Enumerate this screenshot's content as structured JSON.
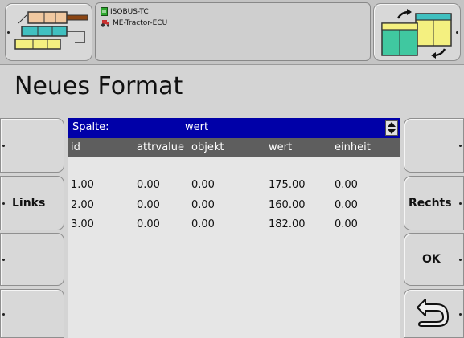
{
  "status": {
    "line1": "ISOBUS-TC",
    "line2": "ME-Tractor-ECU",
    "line1_icon": "document-icon",
    "line2_icon": "tractor-icon"
  },
  "page_title": "Neues Format",
  "table": {
    "selector_label": "Spalte:",
    "selector_value": "wert",
    "columns": [
      "id",
      "attrvalue",
      "objekt",
      "wert",
      "einheit"
    ],
    "rows": [
      [
        "1.00",
        "0.00",
        "0.00",
        "175.00",
        "0.00"
      ],
      [
        "2.00",
        "0.00",
        "0.00",
        "160.00",
        "0.00"
      ],
      [
        "3.00",
        "0.00",
        "0.00",
        "182.00",
        "0.00"
      ]
    ]
  },
  "softkeys": {
    "left_2": "Links",
    "right_2": "Rechts",
    "right_3": "OK",
    "right_4_icon": "back-arrow-icon"
  },
  "colors": {
    "header_blue": "#0000a8",
    "column_header_gray": "#5e5e5e"
  }
}
